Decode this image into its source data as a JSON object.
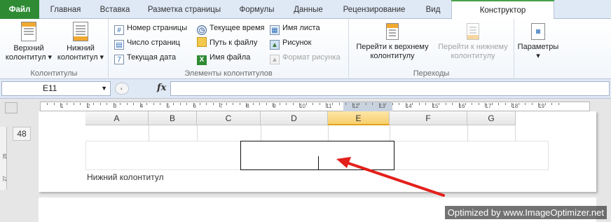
{
  "tabs": [
    {
      "label": "Файл"
    },
    {
      "label": "Главная"
    },
    {
      "label": "Вставка"
    },
    {
      "label": "Разметка страницы"
    },
    {
      "label": "Формулы"
    },
    {
      "label": "Данные"
    },
    {
      "label": "Рецензирование"
    },
    {
      "label": "Вид"
    },
    {
      "label": "Конструктор"
    }
  ],
  "ribbon": {
    "headers_group": {
      "label": "Колонтитулы",
      "header_btn": {
        "line1": "Верхний",
        "line2": "колонтитул ▾"
      },
      "footer_btn": {
        "line1": "Нижний",
        "line2": "колонтитул ▾"
      }
    },
    "elements_group": {
      "label": "Элементы колонтитулов",
      "page_number": "Номер страницы",
      "page_count": "Число страниц",
      "current_date": "Текущая дата",
      "current_time": "Текущее время",
      "file_path": "Путь к файлу",
      "file_name": "Имя файла",
      "sheet_name": "Имя листа",
      "picture": "Рисунок",
      "format_picture": "Формат рисунка"
    },
    "navigation_group": {
      "label": "Переходы",
      "goto_header": {
        "line1": "Перейти к верхнему",
        "line2": "колонтитулу"
      },
      "goto_footer": {
        "line1": "Перейти к нижнему",
        "line2": "колонтитулу"
      }
    },
    "params_group": {
      "label": "Параметры",
      "arrow": "▾"
    }
  },
  "formula_bar": {
    "cell_ref": "E11",
    "fx": "fx",
    "value": ""
  },
  "ruler_numbers": [
    "1",
    "2",
    "3",
    "4",
    "5",
    "6",
    "7",
    "8",
    "9",
    "10",
    "11",
    "12",
    "13",
    "14",
    "15",
    "16",
    "17",
    "18",
    "19"
  ],
  "columns": [
    "A",
    "B",
    "C",
    "D",
    "E",
    "F",
    "G"
  ],
  "selected_column": "E",
  "row_number": "48",
  "vertical_ruler": [
    "26",
    "27"
  ],
  "footer_label": "Нижний колонтитул",
  "watermark": "Optimized by www.ImageOptimizer.net",
  "colors": {
    "file_tab": "#2e8b34",
    "accent": "#e0a31d",
    "arrow": "#e3201b"
  }
}
